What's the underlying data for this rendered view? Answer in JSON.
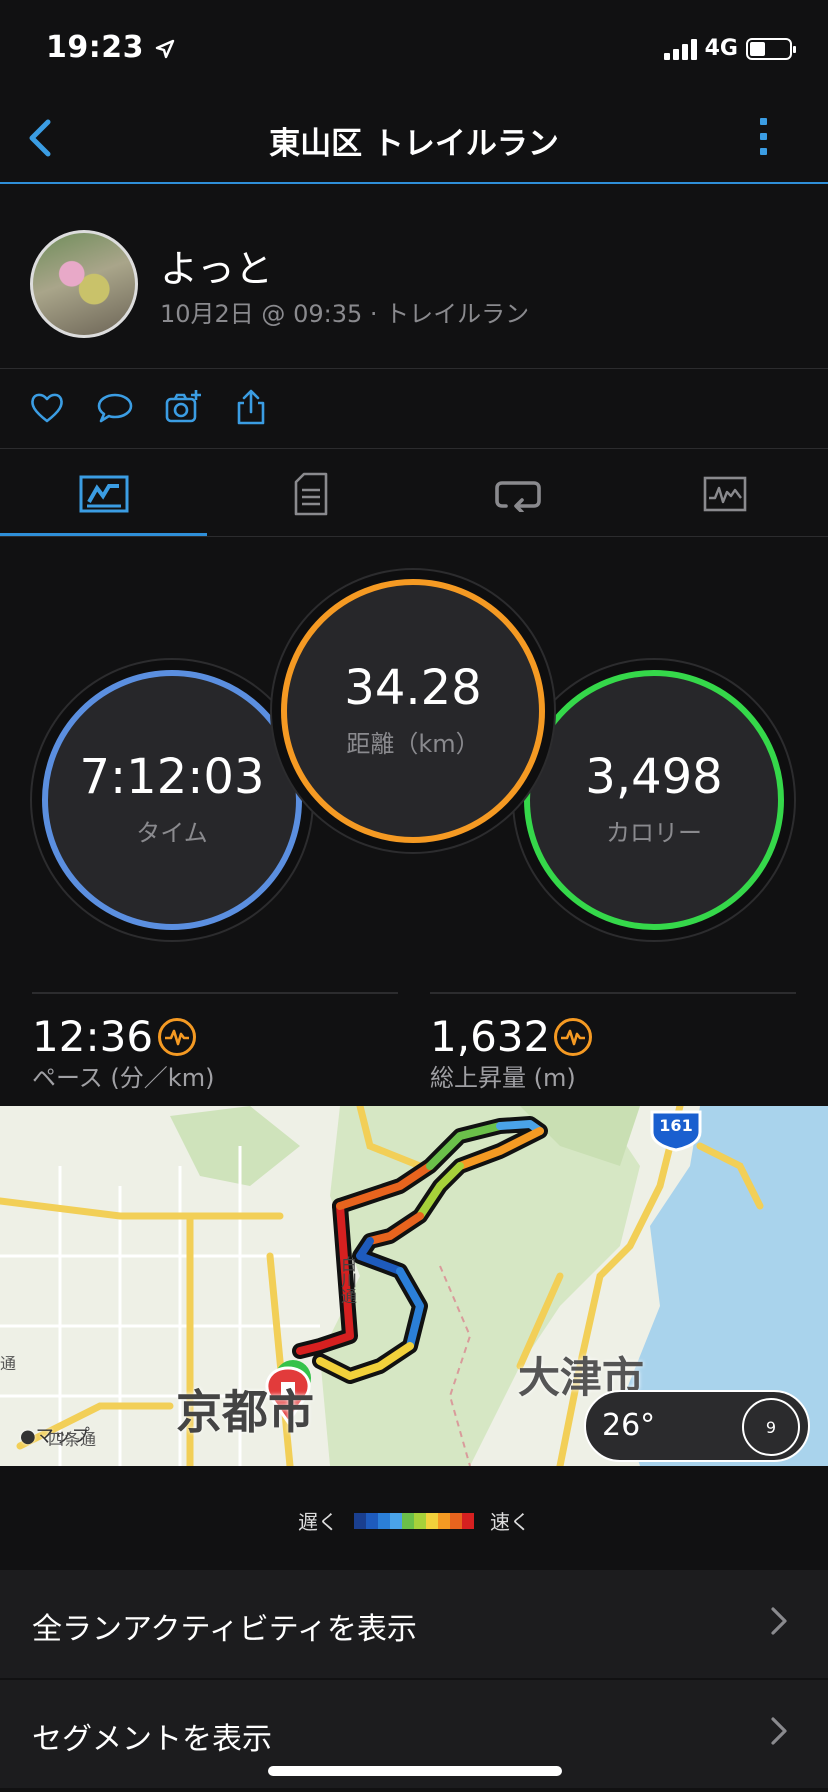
{
  "status_bar": {
    "time": "19:23",
    "network": "4G",
    "battery_percent": 40
  },
  "nav": {
    "title": "東山区 トレイルラン"
  },
  "activity": {
    "user": "よっと",
    "meta": "10月2日 @ 09:35 · トレイルラン"
  },
  "tabs": [
    {
      "icon": "stats-icon",
      "active": true
    },
    {
      "icon": "details-icon",
      "active": false
    },
    {
      "icon": "laps-icon",
      "active": false
    },
    {
      "icon": "chart-icon",
      "active": false
    }
  ],
  "rings": {
    "time": {
      "value": "7:12:03",
      "label": "タイム"
    },
    "distance": {
      "value": "34.28",
      "label": "距離（km）"
    },
    "calories": {
      "value": "3,498",
      "label": "カロリー"
    }
  },
  "stats": {
    "pace": {
      "value": "12:36",
      "label": "ペース (分／km)"
    },
    "ascent": {
      "value": "1,632",
      "label": "総上昇量 (m)"
    }
  },
  "map": {
    "route_badge": "161",
    "city_kyoto": "京都市",
    "city_otsu": "大津市",
    "road_shirakawa": "白川通",
    "road_left": "通",
    "map_brand": "マップ",
    "road_shijo": "四条通"
  },
  "weather": {
    "temp": "26°",
    "wind": "9"
  },
  "legend": {
    "slow": "遅く",
    "fast": "速く",
    "colors": [
      "#1a3f8f",
      "#1e5bbd",
      "#2b7fd8",
      "#4aa3e8",
      "#6bc04a",
      "#a6d13a",
      "#f2d13b",
      "#f59a23",
      "#e8641e",
      "#d62020"
    ]
  },
  "links": [
    {
      "label": "全ランアクティビティを表示"
    },
    {
      "label": "セグメントを表示"
    }
  ]
}
